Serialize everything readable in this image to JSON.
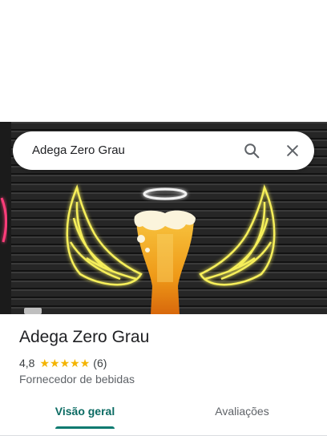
{
  "search": {
    "query": "Adega Zero Grau",
    "search_icon": "search-icon",
    "close_icon": "close-icon"
  },
  "place": {
    "name": "Adega Zero Grau",
    "rating": "4,8",
    "rating_value": 4.8,
    "stars_filled": 5,
    "review_count": "(6)",
    "category": "Fornecedor de bebidas"
  },
  "tabs": [
    {
      "label": "Visão geral",
      "active": true
    },
    {
      "label": "Avaliações",
      "active": false
    }
  ],
  "colors": {
    "accent": "#0b7a70",
    "star": "#f4b400",
    "neon_yellow": "#f6ef5a",
    "beer": "#f2a21b"
  }
}
